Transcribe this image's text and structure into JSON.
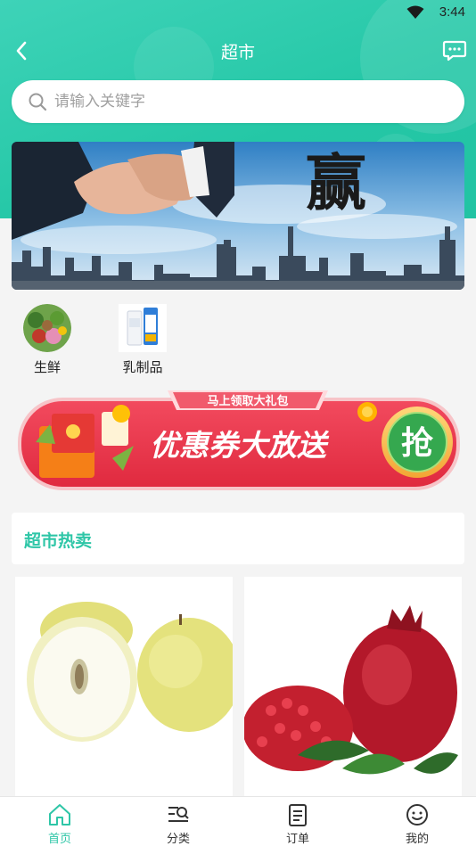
{
  "status_bar": {
    "time": "3:44"
  },
  "header": {
    "title": "超市"
  },
  "search": {
    "placeholder": "请输入关键字"
  },
  "banner": {
    "text": "赢"
  },
  "categories": [
    {
      "label": "生鲜",
      "icon": "fresh-produce-icon"
    },
    {
      "label": "乳制品",
      "icon": "dairy-icon"
    }
  ],
  "promo": {
    "top_text": "马上领取大礼包",
    "main_text": "优惠券大放送",
    "button_text": "抢"
  },
  "hot_section": {
    "title": "超市热卖"
  },
  "products": [
    {
      "image": "pear-image"
    },
    {
      "image": "pomegranate-image"
    }
  ],
  "tabs": [
    {
      "label": "首页",
      "icon": "home-icon",
      "active": true
    },
    {
      "label": "分类",
      "icon": "category-icon",
      "active": false
    },
    {
      "label": "订单",
      "icon": "order-icon",
      "active": false
    },
    {
      "label": "我的",
      "icon": "profile-icon",
      "active": false
    }
  ],
  "colors": {
    "accent": "#2ec6a7",
    "promo_red": "#e8334a"
  }
}
